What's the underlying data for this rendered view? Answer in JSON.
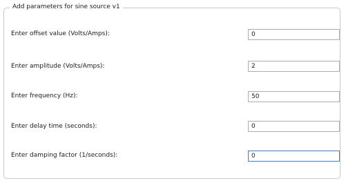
{
  "panel": {
    "title": "Add parameters for sine source v1"
  },
  "fields": [
    {
      "label": "Enter offset value (Volts/Amps):",
      "value": "0"
    },
    {
      "label": "Enter amplitude (Volts/Amps):",
      "value": "2"
    },
    {
      "label": "Enter frequency (Hz):",
      "value": "50"
    },
    {
      "label": "Enter delay time (seconds):",
      "value": "0"
    },
    {
      "label": "Enter damping factor (1/seconds):",
      "value": "0"
    }
  ],
  "colors": {
    "focus_border": "#3c7fc3",
    "field_border": "#acacac",
    "group_border": "#c9c9c9"
  }
}
